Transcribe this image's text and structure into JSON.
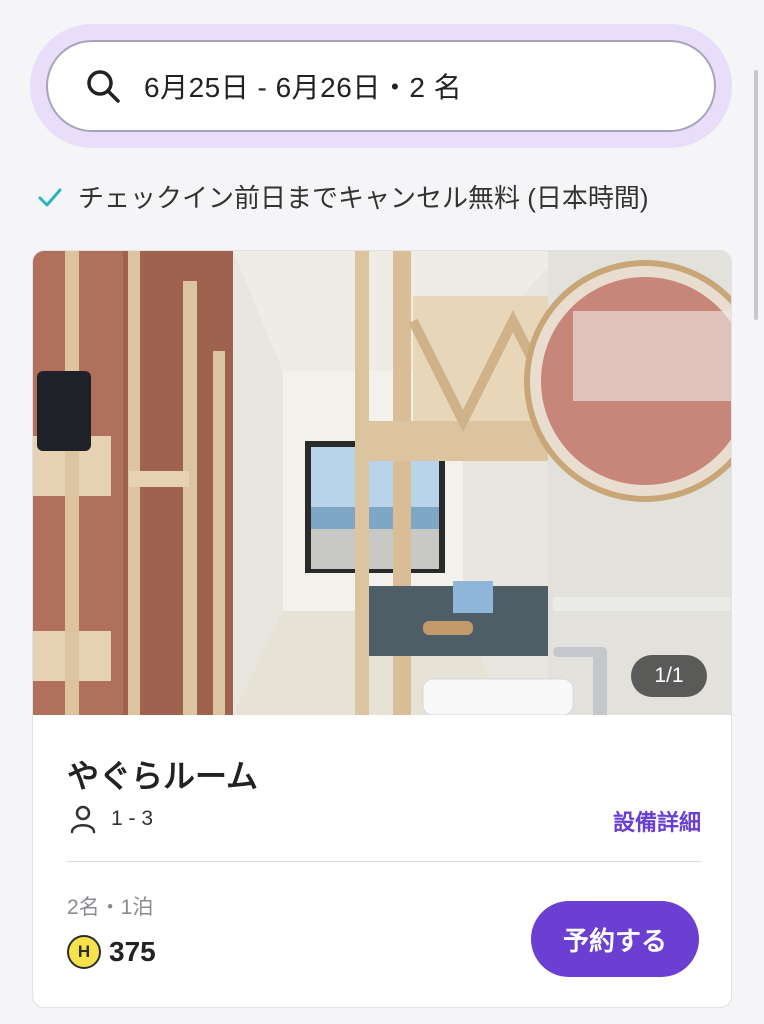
{
  "search": {
    "text": "6月25日 - 6月26日・2 名",
    "icon": "search-icon"
  },
  "cancellation": {
    "text": "チェックイン前日までキャンセル無料 (日本時間)",
    "icon": "check-icon",
    "color": "#2bb3c0"
  },
  "room": {
    "name": "やぐらルーム",
    "capacity": "1 - 3",
    "details_link": "設備詳細",
    "photo_counter": "1/1",
    "stay_info": "2名・1泊",
    "currency_badge": "H",
    "price": "375",
    "book_label": "予約する"
  },
  "colors": {
    "accent": "#6b3fd1",
    "halo": "#e8defa",
    "coin": "#f6e24a"
  }
}
